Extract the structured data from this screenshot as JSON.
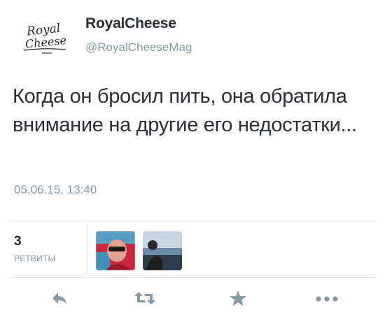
{
  "user": {
    "display_name": "RoyalCheese",
    "screen_name": "@RoyalCheeseMag",
    "avatar_text_line1": "Royal",
    "avatar_text_line2": "Cheese"
  },
  "tweet": {
    "text": "Когда он бросил пить, она обратила внимание на другие его недостатки...",
    "timestamp": "05.06.15, 13:40"
  },
  "stats": {
    "retweet_count": "3",
    "retweet_label": "РЕТВИТЫ",
    "retweeters": [
      "retweeter-avatar-1",
      "retweeter-avatar-2"
    ]
  },
  "actions": [
    "reply-icon",
    "retweet-icon",
    "favorite-icon",
    "more-icon"
  ],
  "colors": {
    "text": "#292f33",
    "muted": "#8899a6",
    "icon": "#8899a6",
    "divider": "#e1e8ed"
  }
}
